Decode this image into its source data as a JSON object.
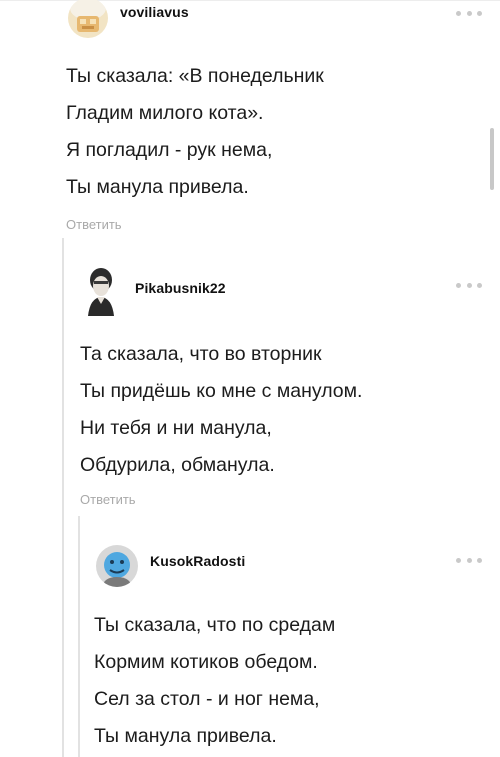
{
  "comments": [
    {
      "username": "voviliavus",
      "avatar": "avatar-voviliavus",
      "lines": [
        "Ты сказала: «В понедельник",
        "Гладим милого кота».",
        "Я погладил - рук нема,",
        "Ты манула привела."
      ],
      "reply_label": "Ответить"
    },
    {
      "username": "Pikabusnik22",
      "avatar": "avatar-pikabusnik22",
      "lines": [
        "Та сказала, что во вторник",
        "Ты придёшь ко мне с манулом.",
        "Ни тебя и ни манула,",
        "Обдурила, обманула."
      ],
      "reply_label": "Ответить"
    },
    {
      "username": "KusokRadosti",
      "avatar": "avatar-kusokradosti",
      "lines": [
        "Ты сказала, что по средам",
        "Кормим котиков обедом.",
        "Сел за стол - и ног нема,",
        "Ты манула привела."
      ]
    }
  ],
  "icons": {
    "more": "more-horizontal-icon"
  },
  "colors": {
    "text": "#1c1c1c",
    "username": "#111111",
    "reply": "#a9a9a9",
    "thread_line": "#e2e2e2",
    "more_dots": "#c9c9c9"
  }
}
